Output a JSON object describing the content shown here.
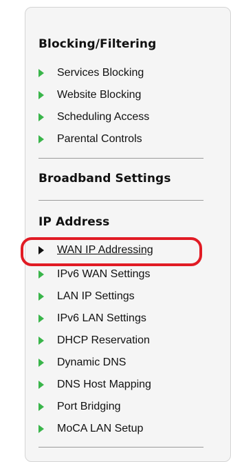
{
  "menu": {
    "blocking": {
      "heading": "Blocking/Filtering",
      "items": [
        {
          "label": "Services Blocking"
        },
        {
          "label": "Website Blocking"
        },
        {
          "label": "Scheduling Access"
        },
        {
          "label": "Parental Controls"
        }
      ]
    },
    "broadband": {
      "heading": "Broadband Settings"
    },
    "ip_address": {
      "heading": "IP Address",
      "items": [
        {
          "label": "WAN IP Addressing",
          "selected": true
        },
        {
          "label": "IPv6 WAN Settings"
        },
        {
          "label": "LAN IP Settings"
        },
        {
          "label": "IPv6 LAN Settings"
        },
        {
          "label": "DHCP Reservation"
        },
        {
          "label": "Dynamic DNS"
        },
        {
          "label": "DNS Host Mapping"
        },
        {
          "label": "Port Bridging"
        },
        {
          "label": "MoCA LAN Setup"
        }
      ]
    }
  },
  "colors": {
    "arrow": "#39b54a",
    "selected_arrow": "#111111",
    "highlight": "#e11b24"
  },
  "icons": {
    "item_icon": "triangle-right-icon",
    "selected_icon": "triangle-right-icon"
  }
}
